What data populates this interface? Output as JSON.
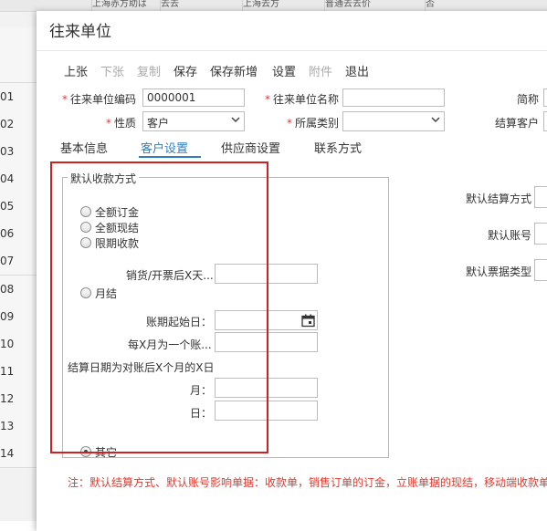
{
  "background": {
    "row_numbers": [
      "01",
      "02",
      "03",
      "04",
      "05",
      "06",
      "07",
      "08",
      "09",
      "10",
      "11",
      "12",
      "13",
      "14"
    ],
    "top_cells": [
      "上海赤方助ば",
      "去去",
      "上海去方",
      "普通去去价",
      "否"
    ]
  },
  "dialog": {
    "title": "往来单位",
    "toolbar": [
      {
        "label": "上张",
        "enabled": true
      },
      {
        "label": "下张",
        "enabled": false
      },
      {
        "label": "复制",
        "enabled": false
      },
      {
        "label": "保存",
        "enabled": true
      },
      {
        "label": "保存新增",
        "enabled": true
      },
      {
        "label": "设置",
        "enabled": true
      },
      {
        "label": "附件",
        "enabled": false
      },
      {
        "label": "退出",
        "enabled": true
      }
    ],
    "form": {
      "code_label": "往来单位编码",
      "code_value": "0000001",
      "name_label": "往来单位名称",
      "name_value": "",
      "abbr_label": "简称",
      "nature_label": "性质",
      "nature_value": "客户",
      "category_label": "所属类别",
      "category_value": "",
      "settle_customer_label": "结算客户",
      "required_mark": "*"
    },
    "tabs": [
      {
        "label": "基本信息",
        "active": false
      },
      {
        "label": "客户设置",
        "active": true
      },
      {
        "label": "供应商设置",
        "active": false
      },
      {
        "label": "联系方式",
        "active": false
      }
    ],
    "payment": {
      "legend": "默认收款方式",
      "options": [
        {
          "label": "全额订金",
          "checked": false
        },
        {
          "label": "全额现结",
          "checked": false
        },
        {
          "label": "限期收款",
          "checked": false
        }
      ],
      "days_label": "销货/开票后X天...",
      "monthly_label": "月结",
      "start_date_label": "账期起始日：",
      "every_x_month_label": "每X月为一个账...",
      "settle_rule_label": "结算日期为对账后X个月的X日",
      "month_label": "月：",
      "day_label": "日：",
      "other_label": "其它",
      "other_checked": true
    },
    "right": {
      "default_settle_method_label": "默认结算方式",
      "default_account_label": "默认账号",
      "default_invoice_type_label": "默认票据类型"
    },
    "note": "注：默认结算方式、默认账号影响单据：收款单，销售订单的订金，立账单据的现结，移动端收款单"
  },
  "colors": {
    "accent": "#2d7fc1",
    "required": "#e33333",
    "highlight_frame": "#cc2222",
    "note": "#e03a2e"
  }
}
